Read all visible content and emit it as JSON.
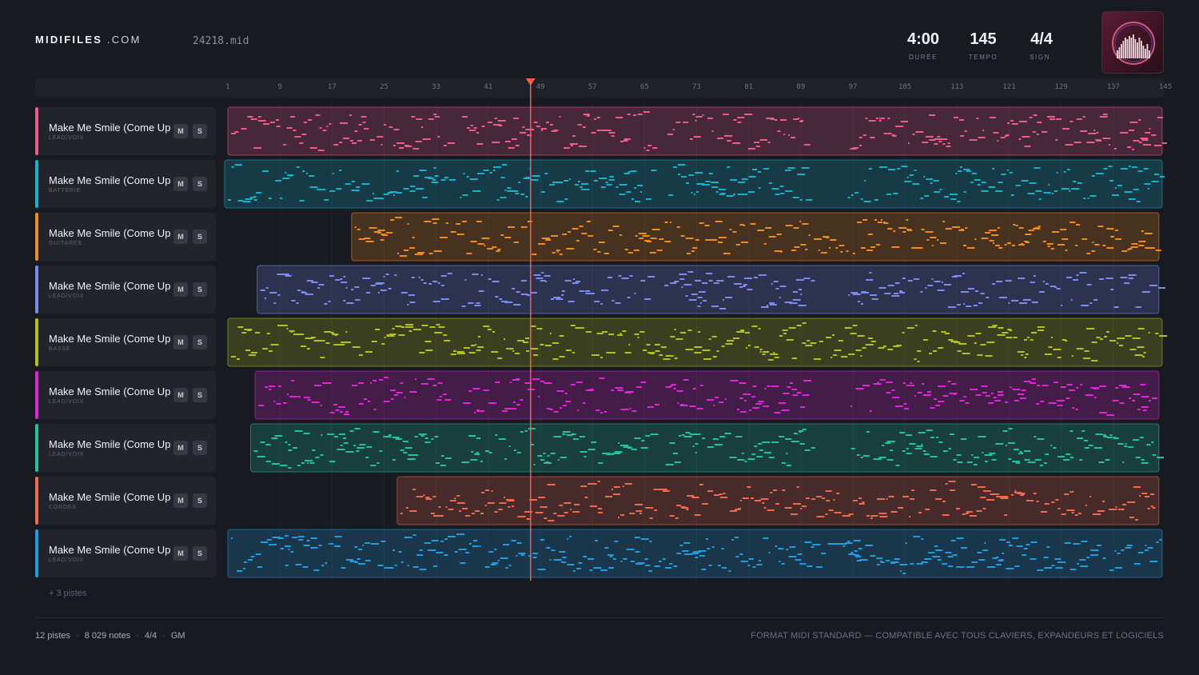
{
  "brand": {
    "name": "MIDIFILES",
    "suffix": ".COM"
  },
  "file": {
    "name": "24218.mid"
  },
  "stats": [
    {
      "value": "4:00",
      "label": "DURÉE"
    },
    {
      "value": "145",
      "label": "TEMPO"
    },
    {
      "value": "4/4",
      "label": "SIGN."
    }
  ],
  "ruler": {
    "ticks": [
      "1",
      "9",
      "17",
      "25",
      "33",
      "41",
      "49",
      "57",
      "65",
      "73",
      "81",
      "89",
      "97",
      "105",
      "113",
      "121",
      "129",
      "137",
      "145"
    ]
  },
  "playhead": {
    "bar": 47.5
  },
  "colors": {
    "accent": "#ff5a4a",
    "background": "#181a21"
  },
  "tracks": [
    {
      "name": "Make Me Smile (Come Up",
      "category": "LEAD/VOIX",
      "color": "#ee5a8c",
      "start": 1,
      "end": 144.5,
      "mute": "M",
      "solo": "S"
    },
    {
      "name": "Make Me Smile (Come Up",
      "category": "BATTERIE",
      "color": "#13b3cc",
      "start": 0.5,
      "end": 144.5,
      "mute": "M",
      "solo": "S"
    },
    {
      "name": "Make Me Smile (Come Up",
      "category": "GUITARES",
      "color": "#f28a1c",
      "start": 20,
      "end": 144,
      "mute": "M",
      "solo": "S"
    },
    {
      "name": "Make Me Smile (Come Up",
      "category": "LEAD/VOIX",
      "color": "#7b8cf0",
      "start": 5.5,
      "end": 144,
      "mute": "M",
      "solo": "S"
    },
    {
      "name": "Make Me Smile (Come Up",
      "category": "BASSE",
      "color": "#b5c21a",
      "start": 1,
      "end": 144.5,
      "mute": "M",
      "solo": "S"
    },
    {
      "name": "Make Me Smile (Come Up",
      "category": "LEAD/VOIX",
      "color": "#e025d8",
      "start": 5.2,
      "end": 144,
      "mute": "M",
      "solo": "S"
    },
    {
      "name": "Make Me Smile (Come Up",
      "category": "LEAD/VOIX",
      "color": "#1fc2a3",
      "start": 4.5,
      "end": 144,
      "mute": "M",
      "solo": "S"
    },
    {
      "name": "Make Me Smile (Come Up",
      "category": "CORDES",
      "color": "#f06a4e",
      "start": 27,
      "end": 144,
      "mute": "M",
      "solo": "S"
    },
    {
      "name": "Make Me Smile (Come Up",
      "category": "LEAD/VOIX",
      "color": "#1e9de0",
      "start": 1,
      "end": 144.5,
      "mute": "M",
      "solo": "S"
    }
  ],
  "more_tracks": "+ 3 pistes",
  "footer": {
    "tracks": "12 pistes",
    "notes": "8 029 notes",
    "signature": "4/4",
    "standard": "GM",
    "note": "FORMAT MIDI STANDARD — COMPATIBLE AVEC TOUS CLAVIERS, EXPANDEURS ET LOGICIELS"
  }
}
